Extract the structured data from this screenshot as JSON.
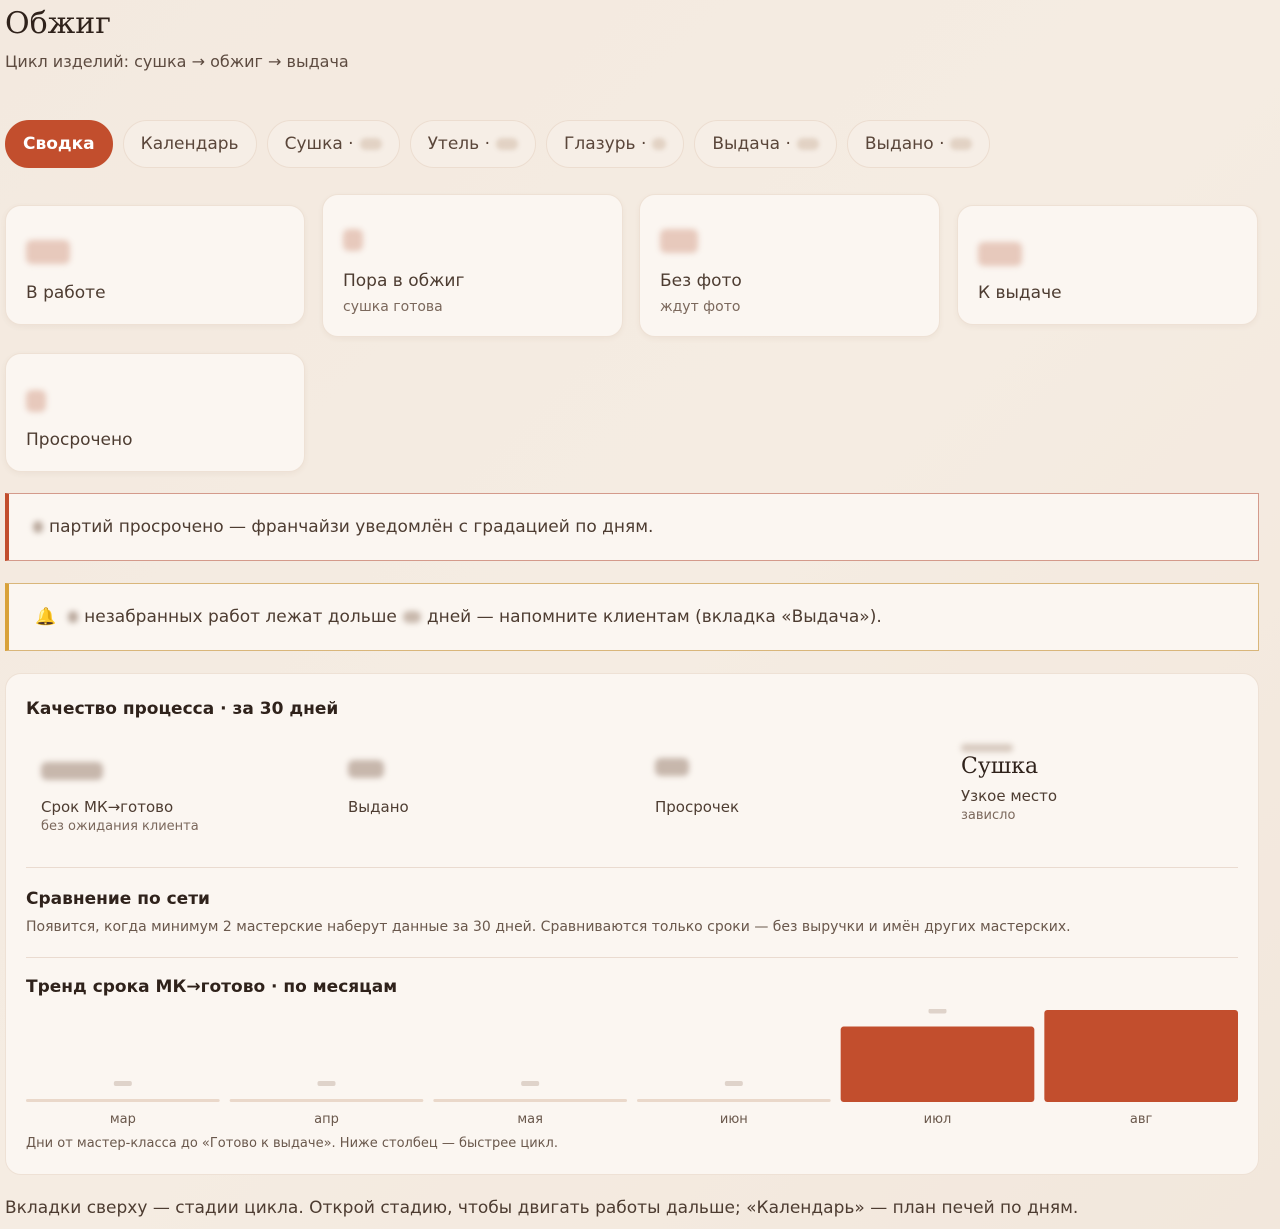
{
  "header": {
    "title": "Обжиг",
    "subtitle": "Цикл изделий: сушка → обжиг → выдача"
  },
  "tabs": [
    {
      "label": "Сводка",
      "active": true
    },
    {
      "label": "Календарь"
    },
    {
      "label": "Сушка ·"
    },
    {
      "label": "Утель ·"
    },
    {
      "label": "Глазурь ·"
    },
    {
      "label": "Выдача ·"
    },
    {
      "label": "Выдано ·"
    }
  ],
  "stats": {
    "in_work": {
      "label": "В работе"
    },
    "fire_ready": {
      "label": "Пора в обжиг",
      "sub": "сушка готова"
    },
    "no_photo": {
      "label": "Без фото",
      "sub": "ждут фото"
    },
    "to_issue": {
      "label": "К выдаче"
    },
    "overdue": {
      "label": "Просрочено"
    }
  },
  "alerts": {
    "overdue_text": "партий просрочено — франчайзи уведомлён с градацией по дням.",
    "pickup_text_1": "незабранных работ лежат дольше",
    "pickup_text_2": "дней — напомните клиентам (вкладка «Выдача»)."
  },
  "quality": {
    "title": "Качество процесса · за 30 дней",
    "metrics": [
      {
        "label": "Срок МК→готово",
        "sub": "без ожидания клиента"
      },
      {
        "label": "Выдано"
      },
      {
        "label": "Просрочек"
      },
      {
        "value_text": "Сушка",
        "label": "Узкое место",
        "sub": "зависло"
      }
    ],
    "network_title": "Сравнение по сети",
    "network_note": "Появится, когда минимум 2 мастерские наберут данные за 30 дней. Сравниваются только сроки — без выручки и имён других мастерских.",
    "trend_title": "Тренд срока МК→готово · по месяцам",
    "trend_note": "Дни от мастер-класса до «Готово к выдаче». Ниже столбец — быстрее цикл."
  },
  "chart_data": {
    "type": "bar",
    "categories": [
      "мар",
      "апр",
      "мая",
      "июн",
      "июл",
      "авг"
    ],
    "values": [
      0,
      0,
      0,
      0,
      0.82,
      1.0
    ],
    "bar_color": "#c24e2d",
    "empty_color": "#ead8ca"
  },
  "footer": {
    "hint": "Вкладки сверху — стадии цикла. Открой стадию, чтобы двигать работы дальше; «Календарь» — план печей по дням."
  }
}
